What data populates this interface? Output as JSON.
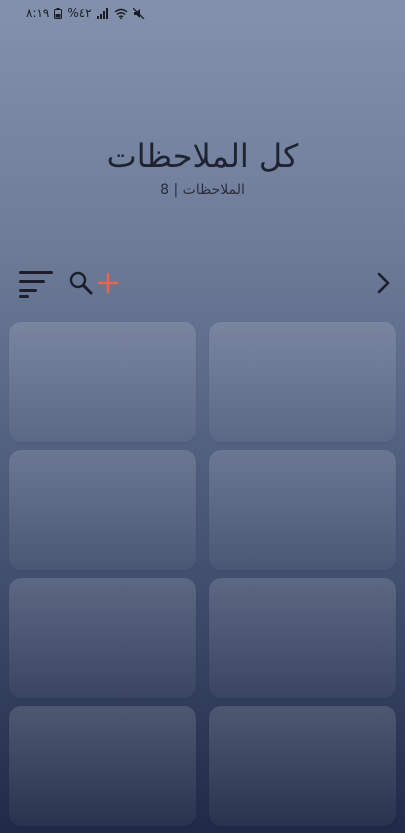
{
  "status_bar": {
    "time": "٨:١٩",
    "battery": "%٤٢",
    "icons": [
      "battery-icon",
      "signal-icon",
      "wifi-icon",
      "mute-icon"
    ]
  },
  "header": {
    "title": "كل الملاحظات",
    "subtitle": "الملاحظات | 8"
  },
  "toolbar": {
    "icons": [
      "sort-icon",
      "search-icon",
      "add-icon",
      "chevron-right-icon"
    ],
    "accent_color": "#e8664e"
  },
  "notes": {
    "count": 8
  }
}
